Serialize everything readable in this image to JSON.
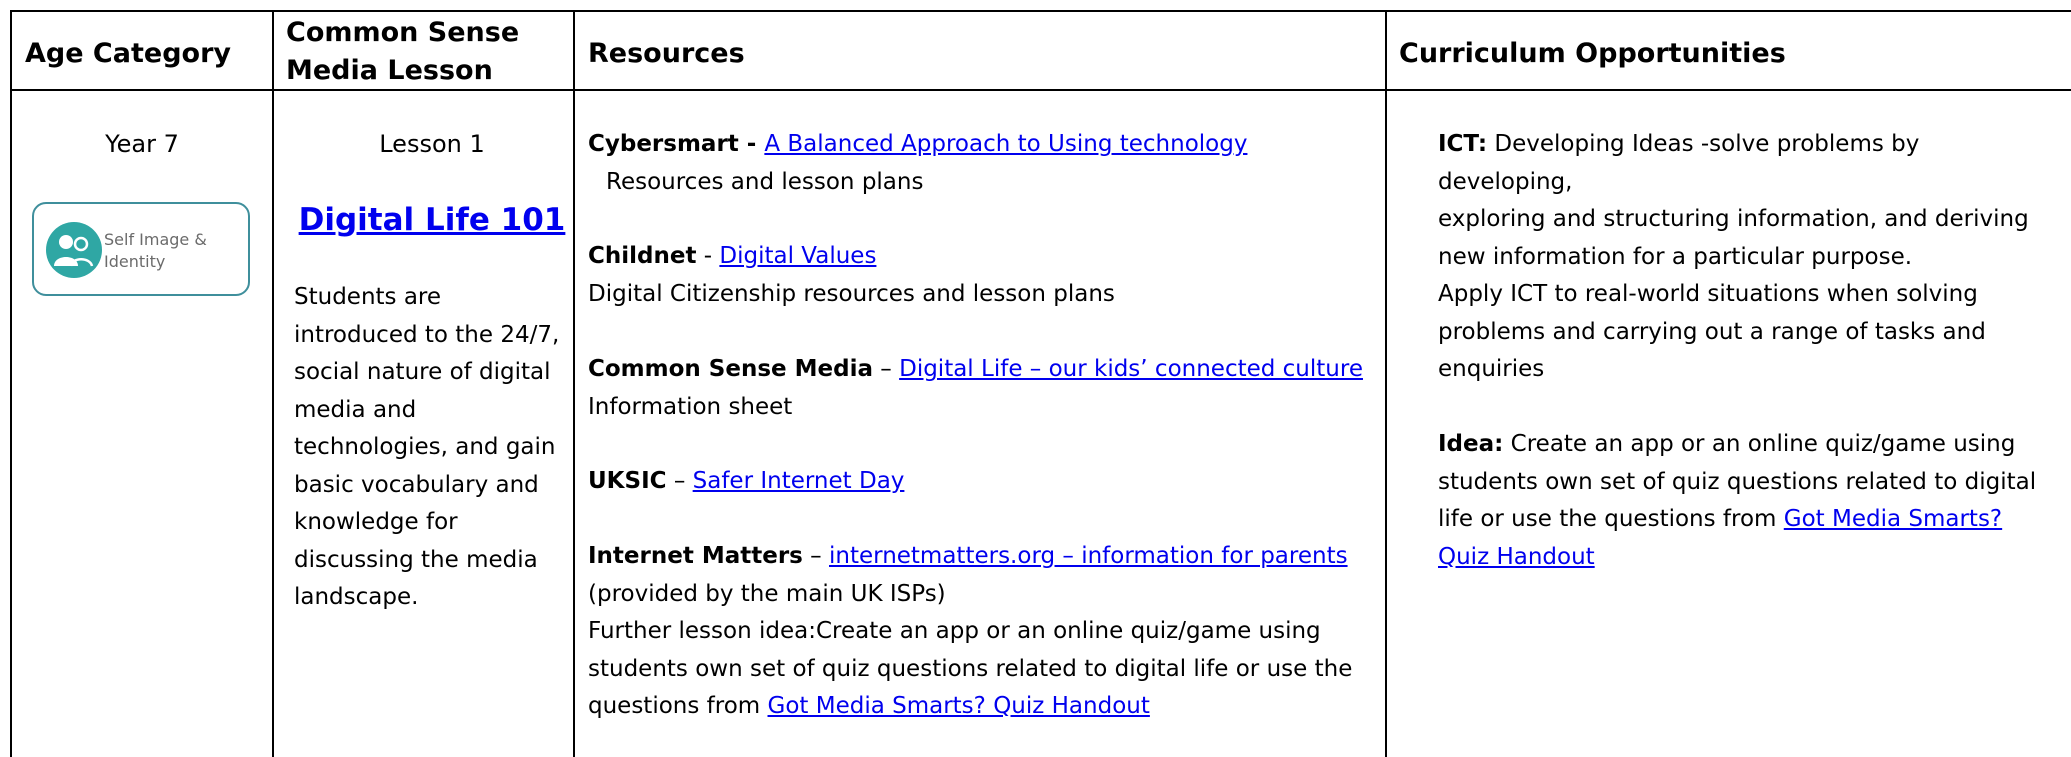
{
  "headers": {
    "age_category": "Age Category",
    "lesson_line1": "Common Sense",
    "lesson_line2": "Media Lesson",
    "resources": "Resources",
    "curriculum": "Curriculum Opportunities"
  },
  "age": {
    "year": "Year 7",
    "badge_line1": "Self Image &",
    "badge_line2": "Identity",
    "badge_icon": "people-silhouette-icon",
    "badge_color": "#2fa7a4"
  },
  "lesson": {
    "number": "Lesson 1",
    "title": "Digital Life 101",
    "description": [
      "Students are",
      "introduced to the 24/7,",
      "social nature of digital",
      "media and",
      "technologies, and gain",
      "basic vocabulary and",
      "knowledge for",
      "discussing the media",
      "landscape."
    ]
  },
  "resources": {
    "cybersmart": {
      "org": "Cybersmart",
      "sep": " - ",
      "link": "A Balanced Approach to Using technology",
      "desc": "Resources and lesson plans"
    },
    "childnet": {
      "org": "Childnet",
      "sep": " - ",
      "link": "Digital Values",
      "desc": "Digital Citizenship resources and lesson plans"
    },
    "csm": {
      "org": "Common Sense Media",
      "sep": " – ",
      "link": "Digital Life – our kids’ connected culture",
      "desc": "Information sheet"
    },
    "uksic": {
      "org": "UKSIC",
      "sep": " – ",
      "link": "Safer Internet Day"
    },
    "internet_matters": {
      "org": "Internet Matters",
      "sep": " – ",
      "link": "internetmatters.org – information for parents",
      "desc": "(provided by the main UK ISPs)",
      "further_line1": "Further lesson idea:Create an app or an online quiz/game using",
      "further_line2": "students own set of quiz questions related to digital life or use the",
      "further_prefix": "questions from ",
      "further_link": "Got Media Smarts? Quiz Handout"
    }
  },
  "curriculum": {
    "ict_label": "ICT:",
    "ict_line1": " Developing Ideas -solve problems by developing,",
    "ict_line2": "exploring and structuring information, and deriving",
    "ict_line3": "new information for a particular purpose.",
    "apply_line1": "Apply ICT to real-world situations when solving",
    "apply_line2": "problems and carrying out a range of tasks and",
    "apply_line3": "enquiries",
    "idea_label": "Idea:",
    "idea_line1": " Create an app or an online quiz/game using",
    "idea_line2": "students own set of quiz questions related to digital",
    "idea_line3_prefix": "life or use the questions from ",
    "idea_link_part1": "Got Media Smarts?",
    "idea_link_part2": "Quiz Handout"
  },
  "colors": {
    "link": "#0000ee",
    "border": "#000000",
    "badge_border": "#3f8f9c"
  }
}
